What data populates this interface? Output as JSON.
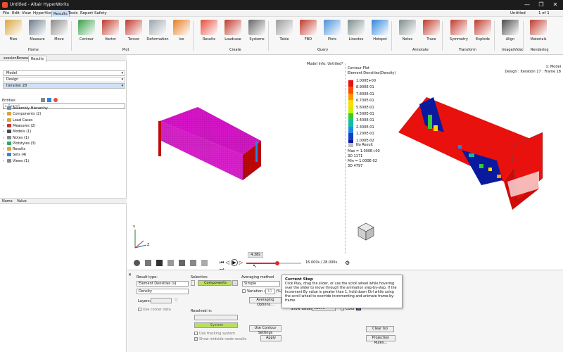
{
  "window": {
    "title": "Untitled - Altair HyperWorks",
    "controls": [
      "—",
      "❐",
      "✕"
    ]
  },
  "menu": {
    "items": [
      "File",
      "Edit",
      "View",
      "HyperView",
      "Results",
      "Tools",
      "Report",
      "Safety"
    ],
    "active_index": 4,
    "right_doc": "Untitled",
    "page_counter": "1 of 1"
  },
  "ribbon": {
    "tools": [
      {
        "label": "Files",
        "icon": "folder-icon",
        "color": "#d8a640"
      },
      {
        "label": "Measure",
        "icon": "measure-icon",
        "color": "#6b7a8a"
      },
      {
        "label": "Move",
        "icon": "move-icon",
        "color": "#8a8a8a"
      },
      {
        "label": "Contour",
        "icon": "contour-icon",
        "color": "#3aa04a"
      },
      {
        "label": "Vector",
        "icon": "vector-icon",
        "color": "#c0392b"
      },
      {
        "label": "Tensor",
        "icon": "tensor-icon",
        "color": "#c0392b"
      },
      {
        "label": "Deformation",
        "icon": "deformation-icon",
        "color": "#9aa4ad"
      },
      {
        "label": "Iso",
        "icon": "iso-icon",
        "color": "#e67e22"
      },
      {
        "label": "Results",
        "icon": "results-icon",
        "color": "#e74c3c"
      },
      {
        "label": "Loadcase",
        "icon": "loadcase-icon",
        "color": "#c0392b"
      },
      {
        "label": "Systems",
        "icon": "systems-icon",
        "color": "#666666"
      },
      {
        "label": "Table",
        "icon": "table-icon",
        "color": "#9a9a9a"
      },
      {
        "label": "FBD",
        "icon": "fbd-icon",
        "color": "#c0392b"
      },
      {
        "label": "Plots",
        "icon": "plots-icon",
        "color": "#4a90d9"
      },
      {
        "label": "Linestox",
        "icon": "linestox-icon",
        "color": "#7f8c8d"
      },
      {
        "label": "Hotspot",
        "icon": "hotspot-icon",
        "color": "#2e86de"
      },
      {
        "label": "Notes",
        "icon": "notes-icon",
        "color": "#7f8c8d"
      },
      {
        "label": "Trace",
        "icon": "trace-icon",
        "color": "#c0392b"
      },
      {
        "label": "Symmetry",
        "icon": "symmetry-icon",
        "color": "#c0392b"
      },
      {
        "label": "Explode",
        "icon": "explode-icon",
        "color": "#c0392b"
      },
      {
        "label": "Align",
        "icon": "align-icon",
        "color": "#4a4a4a"
      },
      {
        "label": "Materials",
        "icon": "materials-icon",
        "color": "#c0392b"
      }
    ],
    "groups": [
      "Home",
      "Plot",
      "Create",
      "Query",
      "Annotate",
      "Transform",
      "Image/Video",
      "Rendering"
    ]
  },
  "left_panel": {
    "tabs": [
      "sessionBrowser",
      "Results"
    ],
    "active_tab": 1,
    "dropdowns": [
      "Model",
      "Design",
      "Iteration 28"
    ],
    "entities_label": "Entities",
    "search_placeholder": "Search",
    "tree": [
      {
        "label": "Assembly Hierarchy",
        "color": "#6b8fb5"
      },
      {
        "label": "Components (2)",
        "color": "#d9a33a"
      },
      {
        "label": "Load Cases",
        "color": "#d9a33a"
      },
      {
        "label": "Measures (2)",
        "color": "#c0392b"
      },
      {
        "label": "Models (1)",
        "color": "#4a4a4a"
      },
      {
        "label": "Notes (1)",
        "color": "#7f8c8d"
      },
      {
        "label": "Plotstyles (3)",
        "color": "#27ae60"
      },
      {
        "label": "Results",
        "color": "#d9a33a"
      },
      {
        "label": "Sets (4)",
        "color": "#2e86de"
      },
      {
        "label": "Views (1)",
        "color": "#7f8c8d"
      }
    ],
    "props_header": {
      "name": "Name",
      "value": "Value"
    }
  },
  "viewport": {
    "model_info": "Model Info: Untitled*",
    "right_info": [
      "1: Model",
      "Design : Iteration 17 : Frame 18"
    ],
    "legend_title": [
      "Contour Plot",
      "Element Densities(Density)"
    ],
    "legend_labels": [
      "1.000E+00",
      "8.900E-01",
      "7.800E-01",
      "6.700E-01",
      "5.600E-01",
      "4.500E-01",
      "3.400E-01",
      "2.300E-01",
      "1.200E-01",
      "1.000E-02"
    ],
    "legend_colors": [
      "#e8110d",
      "#ff4d00",
      "#ff9900",
      "#ffdd00",
      "#c8f000",
      "#33cc33",
      "#11bbaa",
      "#1e88e5",
      "#1040c8",
      "#0a1a9e"
    ],
    "no_result": "No Result",
    "stats": [
      "Max = 1.000E+00",
      "3D 1171",
      "Min = 1.000E-02",
      "3D 4797"
    ]
  },
  "animation": {
    "speed_label": "4.38s",
    "time": "16.000s / 28.000s",
    "progress": 0.57
  },
  "bottom": {
    "result_type_label": "Result type:",
    "result_type_value": "Element Densities (s)",
    "result_sub_value": "Density",
    "layers_label": "Layers:",
    "use_corner_data": "Use corner data",
    "selection_label": "Selection:",
    "selection_value": "Components",
    "averaging_label": "Averaging method",
    "averaging_value": "Simple",
    "variation_label": "Variation <",
    "variation_value": "10",
    "variation_unit": "(%)",
    "averaging_options": "Averaging Options...",
    "resolved_in_label": "Resolved in:",
    "system_value": "System",
    "use_tracking": "Use tracking system",
    "show_midside": "Show midside node results",
    "use_contour_settings": "Use Contour Settings",
    "apply": "Apply",
    "show_values_label": "Show values:",
    "show_values_value": "Above",
    "color_label": "Color",
    "clear_iso": "Clear Iso",
    "projection_rules": "Projection Rules..."
  },
  "tooltip": {
    "title": "Current Step",
    "body": "Click Play, drag the slider, or use the scroll wheel while hovering over the slider to move through the animation step-by-step. If the Increment By value is greater than 1, hold down Ctrl while using the scroll wheel to override incrementing and animate frame-by-frame."
  }
}
